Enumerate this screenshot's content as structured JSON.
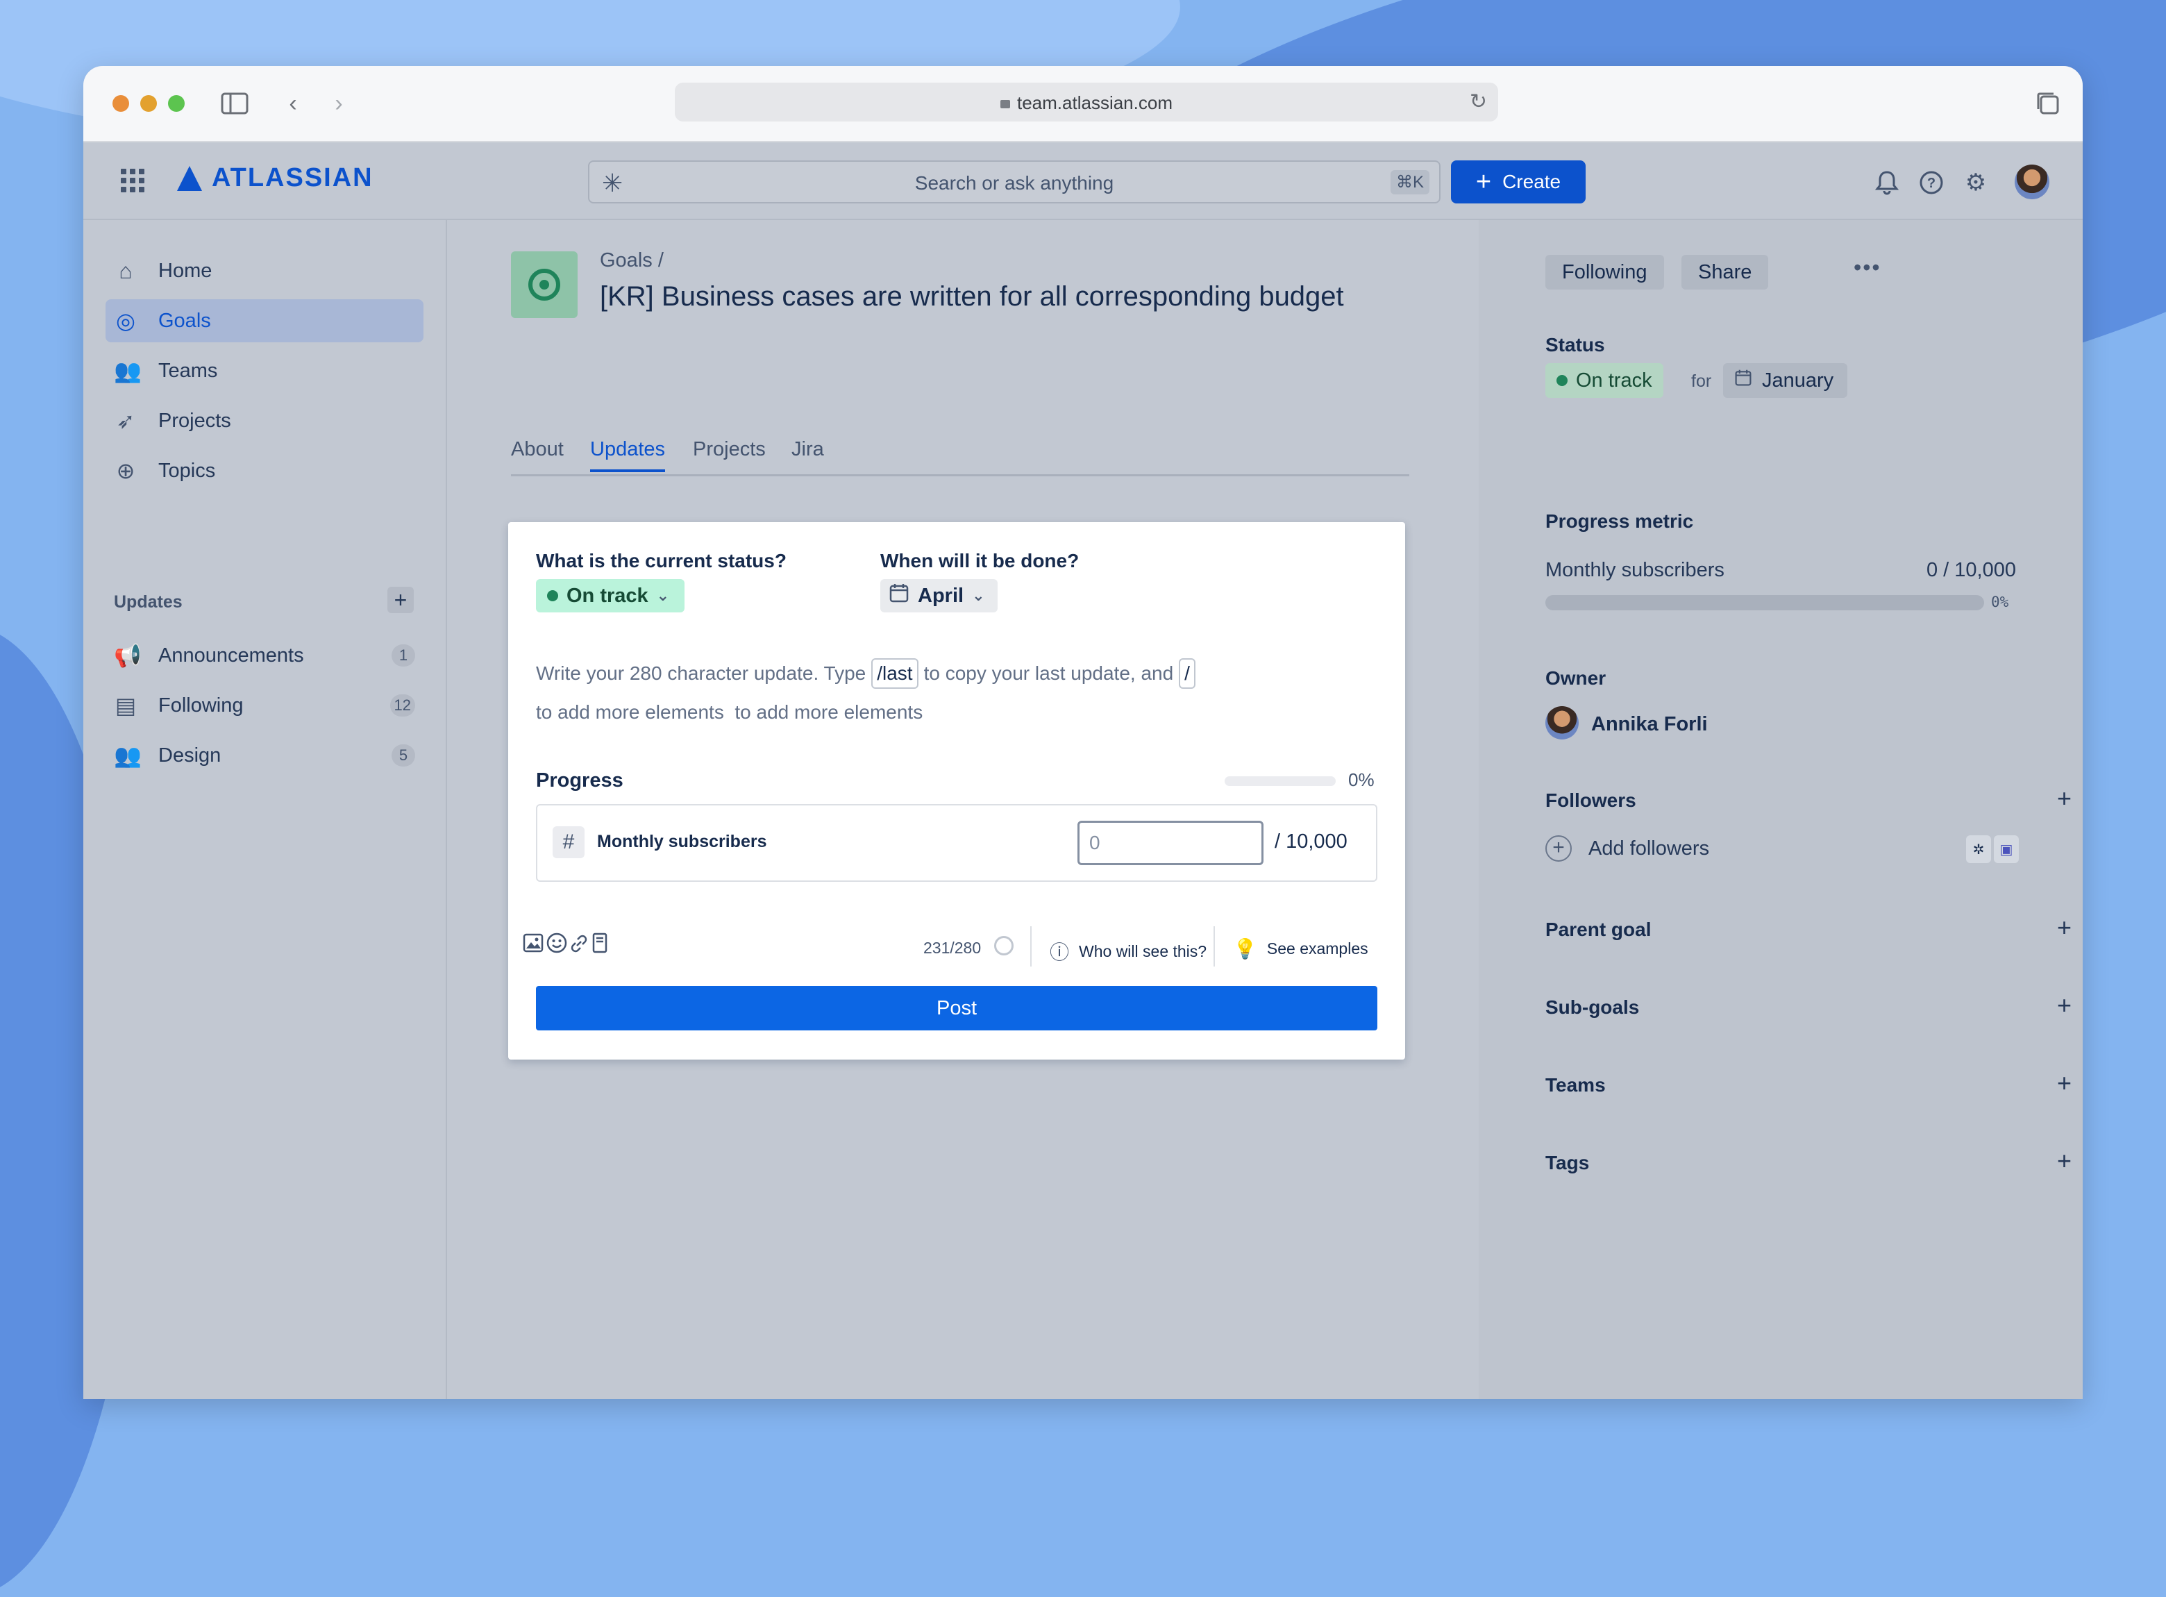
{
  "browser": {
    "url": "team.atlassian.com"
  },
  "topbar": {
    "brand": "ATLASSIAN",
    "search_placeholder": "Search or ask anything",
    "search_shortcut": "⌘K",
    "create_label": "Create"
  },
  "sidebar": {
    "items": [
      {
        "label": "Home",
        "icon": "home-icon"
      },
      {
        "label": "Goals",
        "icon": "goal-target-icon",
        "active": true
      },
      {
        "label": "Teams",
        "icon": "people-icon"
      },
      {
        "label": "Projects",
        "icon": "rocket-icon"
      },
      {
        "label": "Topics",
        "icon": "globe-icon"
      }
    ],
    "updates_heading": "Updates",
    "updates": [
      {
        "label": "Announcements",
        "count": "1",
        "icon": "megaphone-icon"
      },
      {
        "label": "Following",
        "count": "12",
        "icon": "newspaper-icon"
      },
      {
        "label": "Design",
        "count": "5",
        "icon": "people-icon"
      }
    ]
  },
  "main": {
    "breadcrumb": "Goals  /",
    "title": "[KR] Business cases are written for all corresponding budget",
    "tabs": [
      "About",
      "Updates",
      "Projects",
      "Jira"
    ],
    "active_tab": "Updates",
    "form": {
      "status_question": "What is the current status?",
      "status_value": "On track",
      "date_question": "When will it be done?",
      "date_value": "April",
      "prompt_part1": "Write your 280 character update. Type",
      "prompt_kbd1": "/last",
      "prompt_part2": "to copy your last update, and",
      "prompt_kbd2": "/",
      "prompt_part3": "to add more elements",
      "prompt_part4": "to add more elements",
      "progress_label": "Progress",
      "progress_percent_text": "0%",
      "progress_value": 0,
      "metric_name": "Monthly subscribers",
      "metric_placeholder": "0",
      "metric_total": "/ 10,000",
      "char_count": "231/280",
      "who_sees": "Who will see this?",
      "examples": "See examples",
      "post_label": "Post"
    }
  },
  "right_panel": {
    "following_label": "Following",
    "share_label": "Share",
    "status_heading": "Status",
    "status_value": "On track",
    "for_text": "for",
    "month": "January",
    "progress_heading": "Progress metric",
    "metric_name": "Monthly subscribers",
    "metric_value": "0 / 10,000",
    "metric_percent_text": "0%",
    "metric_progress": 0,
    "owner_heading": "Owner",
    "owner_name": "Annika Forli",
    "followers_heading": "Followers",
    "add_followers": "Add followers",
    "parent_goal": "Parent goal",
    "sub_goals": "Sub-goals",
    "teams": "Teams",
    "tags": "Tags"
  },
  "colors": {
    "brand": "#0c52cc",
    "primary_button": "#0c66e4",
    "on_track": "#1f845a"
  }
}
